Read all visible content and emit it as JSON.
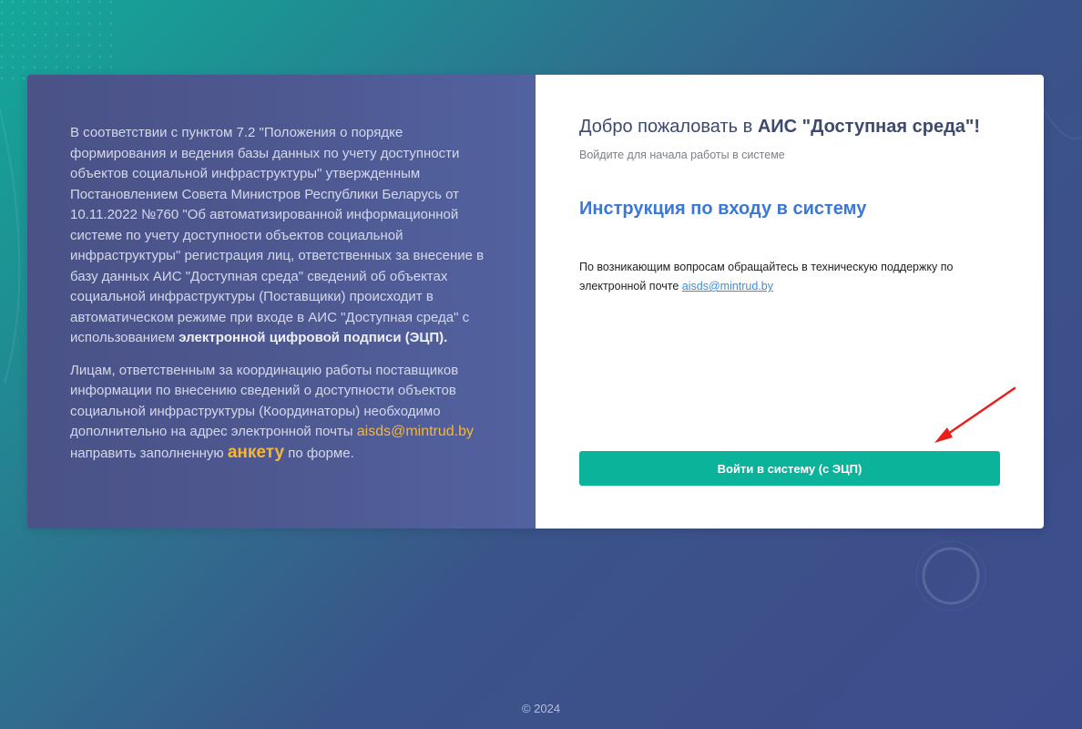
{
  "left": {
    "para1_text": "В соответствии с пунктом 7.2 \"Положения о порядке формирования и ведения базы данных по учету доступности объектов социальной инфраструктуры\" утвержденным Постановлением Совета Министров Республики Беларусь от 10.11.2022 №760 \"Об автоматизированной информационной системе по учету доступности объектов социальной инфраструктуры\" регистрация лиц, ответственных за внесение в базу данных АИС \"Доступная среда\" сведений об объектах социальной инфраструктуры (Поставщики) происходит в автоматическом режиме при входе в АИС \"Доступная среда\" с использованием",
    "para1_strong": "электронной цифровой подписи (ЭЦП).",
    "para2_text": "Лицам, ответственным за координацию работы поставщиков информации по внесению сведений о доступности объектов социальной инфраструктуры (Координаторы) необходимо дополнительно на адрес электронной почты",
    "para2_email": "aisds@mintrud.by",
    "para2_text2": "направить заполненную",
    "para2_form_link": "анкету",
    "para2_text3": "по форме."
  },
  "right": {
    "welcome_prefix": "Добро пожаловать в",
    "welcome_strong": "АИС \"Доступная среда\"!",
    "subtitle": "Войдите для начала работы в системе",
    "instruction_link": "Инструкция по входу в систему",
    "support_text": "По возникающим вопросам обращайтесь в техническую поддержку по электронной почте",
    "support_email": "aisds@mintrud.by",
    "login_button": "Войти в систему (с ЭЦП)"
  },
  "footer": {
    "copyright": "© 2024"
  },
  "colors": {
    "accent_green": "#0bb39a",
    "link_blue": "#3b78d6",
    "link_orange": "#f5b63a",
    "arrow_red": "#e8201c"
  },
  "icons": {
    "arrow": "red-arrow-icon"
  }
}
